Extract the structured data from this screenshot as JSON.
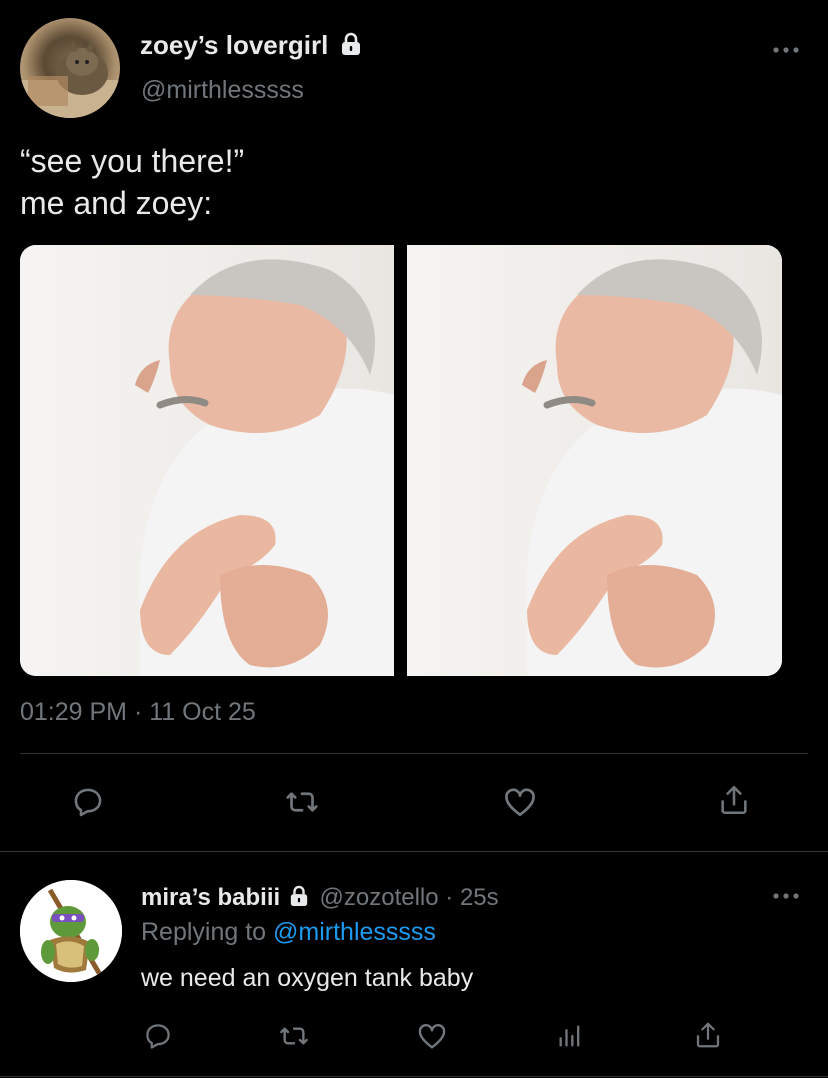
{
  "tweet": {
    "display_name": "zoey’s lovergirl",
    "handle": "@mirthlesssss",
    "text_line1": "“see you there!”",
    "text_line2": "me and zoey:",
    "timestamp": "01:29 PM · 11 Oct 25",
    "images": [
      {
        "alt": "man holding chest"
      },
      {
        "alt": "man holding chest"
      }
    ],
    "actions": {
      "reply_icon": "reply-icon",
      "retweet_icon": "retweet-icon",
      "like_icon": "heart-icon",
      "share_icon": "share-icon"
    }
  },
  "reply": {
    "display_name": "mira’s babiii",
    "handle": "@zozotello",
    "time": "· 25s",
    "replying_label": "Replying to",
    "replying_handle": "@mirthlesssss",
    "text": "we need an oxygen tank baby",
    "actions": {
      "reply_icon": "reply-icon",
      "retweet_icon": "retweet-icon",
      "like_icon": "heart-icon",
      "analytics_icon": "analytics-icon",
      "share_icon": "share-icon"
    }
  },
  "colors": {
    "background": "#000000",
    "text": "#e7e9ea",
    "muted": "#71767b",
    "link": "#1d9bf0",
    "divider": "#2f3336"
  }
}
